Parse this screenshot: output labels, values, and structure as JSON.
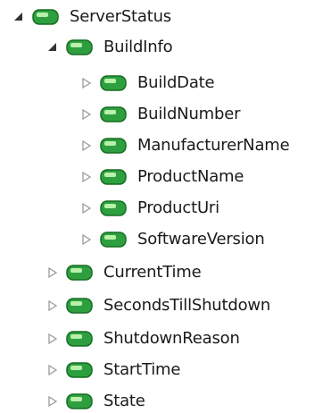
{
  "colors": {
    "background": "#ffffff",
    "text": "#1a1a1a",
    "node_fill": "#2e9f3f",
    "node_dark": "#156f22",
    "node_light": "#b8f1a9",
    "expanded_arrow": "#333333",
    "collapsed_arrow": "#9a9a9a"
  },
  "tree": {
    "root": {
      "label": "ServerStatus",
      "expanded": true,
      "icon": "green-variable-icon",
      "children": {
        "build_info": {
          "label": "BuildInfo",
          "expanded": true,
          "icon": "green-variable-icon",
          "children": [
            {
              "label": "BuildDate",
              "expanded": false,
              "icon": "green-variable-icon"
            },
            {
              "label": "BuildNumber",
              "expanded": false,
              "icon": "green-variable-icon"
            },
            {
              "label": "ManufacturerName",
              "expanded": false,
              "icon": "green-variable-icon"
            },
            {
              "label": "ProductName",
              "expanded": false,
              "icon": "green-variable-icon"
            },
            {
              "label": "ProductUri",
              "expanded": false,
              "icon": "green-variable-icon"
            },
            {
              "label": "SoftwareVersion",
              "expanded": false,
              "icon": "green-variable-icon"
            }
          ]
        },
        "others": [
          {
            "label": "CurrentTime",
            "expanded": false,
            "icon": "green-variable-icon"
          },
          {
            "label": "SecondsTillShutdown",
            "expanded": false,
            "icon": "green-variable-icon"
          },
          {
            "label": "ShutdownReason",
            "expanded": false,
            "icon": "green-variable-icon"
          },
          {
            "label": "StartTime",
            "expanded": false,
            "icon": "green-variable-icon"
          },
          {
            "label": "State",
            "expanded": false,
            "icon": "green-variable-icon"
          }
        ]
      }
    }
  }
}
